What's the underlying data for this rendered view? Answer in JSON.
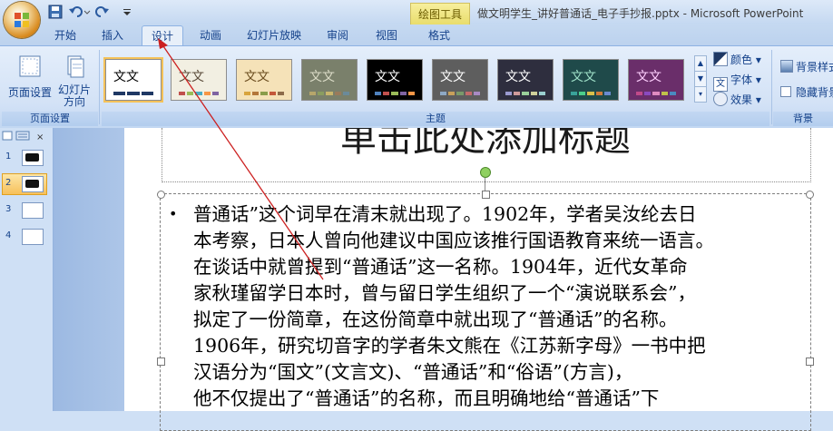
{
  "window": {
    "title": "做文明学生_讲好普通话_电子手抄报.pptx - Microsoft PowerPoint",
    "context_tab_group": "绘图工具"
  },
  "quick_access": {
    "save_icon": "save-icon",
    "undo_icon": "undo-icon",
    "redo_icon": "redo-icon",
    "customize_icon": "customize-icon"
  },
  "tabs": [
    "开始",
    "插入",
    "设计",
    "动画",
    "幻灯片放映",
    "审阅",
    "视图",
    "格式"
  ],
  "active_tab": "设计",
  "ribbon": {
    "page_setup_group": {
      "label": "页面设置",
      "buttons": [
        "页面设置",
        "幻灯片",
        "方向"
      ]
    },
    "themes_group": {
      "label": "主题",
      "theme_sample_text": "文文",
      "themes": [
        {
          "bg": "#ffffff",
          "fg": "#000000",
          "colors": [
            "#1f3864",
            "#1f3864",
            "#1f3864"
          ]
        },
        {
          "bg": "#f2efe2",
          "fg": "#5a4b3a",
          "colors": [
            "#c0504d",
            "#9bbb59",
            "#4bacc6",
            "#f79646",
            "#8064a2"
          ]
        },
        {
          "bg": "#f5e2b8",
          "fg": "#6b4d1f",
          "colors": [
            "#d8a43d",
            "#b3763a",
            "#8a9d4a",
            "#c4583a",
            "#8c6b4a"
          ]
        },
        {
          "bg": "#7a806b",
          "fg": "#dcdcc8",
          "colors": [
            "#b6a66b",
            "#8a9d60",
            "#c9b66d",
            "#9a7a5b",
            "#6b8a9a"
          ]
        },
        {
          "bg": "#000000",
          "fg": "#ffffff",
          "colors": [
            "#4f81bd",
            "#c0504d",
            "#9bbb59",
            "#8064a2",
            "#f79646"
          ]
        },
        {
          "bg": "#5e5e5e",
          "fg": "#ffffff",
          "colors": [
            "#8ea8c4",
            "#c8a05a",
            "#7a9a6a",
            "#c46b6b",
            "#a88ac4"
          ]
        },
        {
          "bg": "#2e2e3e",
          "fg": "#ffffff",
          "colors": [
            "#9a9acf",
            "#cf9a9a",
            "#9acf9a",
            "#cfcf9a",
            "#9acfcf"
          ]
        },
        {
          "bg": "#1f4a4a",
          "fg": "#9fe0c8",
          "colors": [
            "#39a39a",
            "#4bcf8a",
            "#d8c04a",
            "#cf7a3a",
            "#6a8acf"
          ]
        },
        {
          "bg": "#6a2e6a",
          "fg": "#ffd0ff",
          "colors": [
            "#c04a8a",
            "#8a4ac0",
            "#e08ac0",
            "#c0c04a",
            "#4a8ac0"
          ]
        }
      ]
    },
    "theme_options": {
      "colors": "颜色",
      "fonts": "字体",
      "effects": "效果"
    },
    "background_group": {
      "label": "背景",
      "background_styles": "背景样式",
      "hide_background": "隐藏背景"
    }
  },
  "slides_pane": {
    "slides": [
      {
        "number": "1"
      },
      {
        "number": "2"
      },
      {
        "number": "3"
      },
      {
        "number": "4"
      }
    ],
    "selected_slide": "2"
  },
  "slide": {
    "title_placeholder": "单击此处添加标题",
    "body_lines": [
      "普通话”这个词早在清末就出现了。1902年，学者吴汝纶去日",
      "本考察，日本人曾向他建议中国应该推行国语教育来统一语言。",
      "在谈话中就曾提到“普通话”这一名称。1904年，近代女革命",
      "家秋瑾留学日本时，曾与留日学生组织了一个“演说联系会”，",
      "拟定了一份简章，在这份简章中就出现了“普通话”的名称。",
      "1906年，研究切音字的学者朱文熊在《江苏新字母》一书中把",
      "汉语分为“国文”(文言文)、“普通话”和“俗语”(方言)，",
      "他不仅提出了“普通话”的名称，而且明确地给“普通话”下"
    ]
  },
  "colors": {
    "ribbon_text": "#15428b",
    "annotation_arrow": "#cc2020",
    "selected_highlight": "#f7c05a"
  }
}
